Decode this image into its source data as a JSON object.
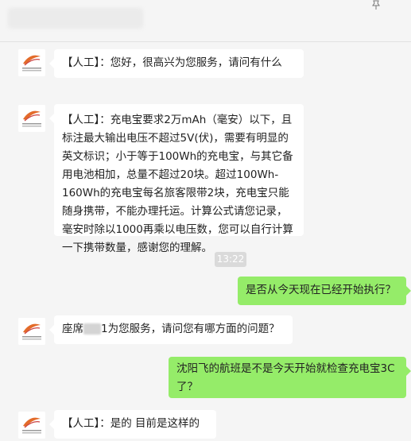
{
  "header": {
    "pin_icon": "pin-icon"
  },
  "messages": [
    {
      "text": "【人工】：您好，很高兴为您服务，请问有什么"
    },
    {
      "text": "【人工】：充电宝要求2万mAh（毫安）以下，且标注最大输出电压不超过5V(伏)，需要有明显的英文标识；小于等于100Wh的充电宝，与其它备用电池相加，总量不超过20块。超过100Wh-160Wh的充电宝每名旅客限带2块，充电宝只能随身携带，不能办理托运。计算公式请您记录，毫安时除以1000再乘以电压数，您可以自行计算一下携带数量，感谢您的理解。"
    },
    {
      "text": "是否从今天现在已经开始执行？"
    },
    {
      "prefix": "座席",
      "suffix": "1为您服务，请问您有哪方面的问题？"
    },
    {
      "text": "沈阳飞的航班是不是今天开始就检查充电宝3C了？"
    },
    {
      "text": "【人工】：是的 目前是这样的"
    }
  ],
  "timestamp": "13:22",
  "colors": {
    "background": "#f5f5f5",
    "bubble_left": "#ffffff",
    "bubble_right": "#95ec69",
    "timestamp_bg": "#dadada"
  }
}
